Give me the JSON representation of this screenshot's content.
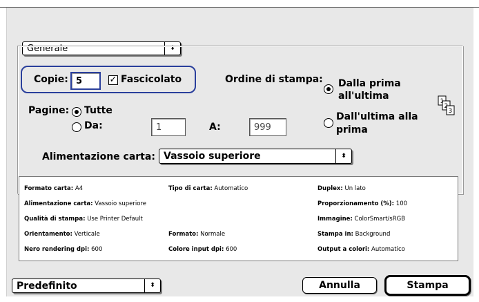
{
  "preset_menu": {
    "value": "Generale"
  },
  "copies": {
    "label": "Copie:",
    "value": "5"
  },
  "collate": {
    "label": "Fascicolato",
    "checked": true
  },
  "print_order": {
    "label": "Ordine di stampa:",
    "options": [
      {
        "label_line1": "Dalla prima",
        "label_line2": "all'ultima",
        "selected": true
      },
      {
        "label_line1": "Dall'ultima alla",
        "label_line2": "prima",
        "selected": false
      }
    ]
  },
  "pages": {
    "label": "Pagine:",
    "all_label": "Tutte",
    "from_label": "Da:",
    "from_value": "1",
    "to_label": "A:",
    "to_value": "999",
    "selected": "all"
  },
  "paper_source": {
    "label": "Alimentazione carta:",
    "value": "Vassoio superiore"
  },
  "summary": {
    "rows": [
      [
        {
          "key": "Formato carta:",
          "val": "A4"
        },
        {
          "key": "Tipo di carta:",
          "val": "Automatico"
        },
        {
          "key": "Duplex:",
          "val": "Un lato"
        }
      ],
      [
        {
          "key": "Alimentazione carta:",
          "val": "Vassoio superiore"
        },
        {
          "key": "Proporzionamento (%):",
          "val": "100"
        }
      ],
      [
        {
          "key": "Qualità di stampa:",
          "val": "Use Printer Default"
        },
        {
          "key": "Immagine:",
          "val": "ColorSmart/sRGB"
        }
      ],
      [
        {
          "key": "Orientamento:",
          "val": "Verticale"
        },
        {
          "key": "Formato:",
          "val": "Normale"
        },
        {
          "key": "Stampa in:",
          "val": "Background"
        }
      ],
      [
        {
          "key": "Nero rendering dpi:",
          "val": "600"
        },
        {
          "key": "Colore input dpi:",
          "val": "600"
        },
        {
          "key": "Output a colori:",
          "val": "Automatico"
        }
      ]
    ]
  },
  "settings_menu": {
    "value": "Predefinito"
  },
  "buttons": {
    "cancel": "Annulla",
    "print": "Stampa"
  },
  "icons": {
    "order": "page-order-icon",
    "updown": "updown-arrows-icon"
  }
}
